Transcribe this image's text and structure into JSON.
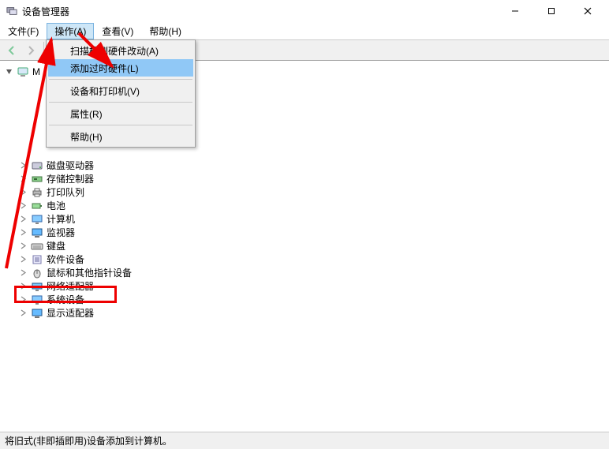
{
  "window": {
    "title": "设备管理器"
  },
  "menubar": {
    "file": "文件(F)",
    "action": "操作(A)",
    "view": "查看(V)",
    "help": "帮助(H)"
  },
  "dropdown": {
    "scan": "扫描检测硬件改动(A)",
    "addLegacy": "添加过时硬件(L)",
    "devPrinters": "设备和打印机(V)",
    "properties": "属性(R)",
    "help": "帮助(H)"
  },
  "tree": {
    "root": "M",
    "items": [
      "磁盘驱动器",
      "存储控制器",
      "打印队列",
      "电池",
      "计算机",
      "监视器",
      "键盘",
      "软件设备",
      "鼠标和其他指针设备",
      "网络适配器",
      "系统设备",
      "显示适配器"
    ]
  },
  "statusbar": {
    "text": "将旧式(非即插即用)设备添加到计算机。"
  },
  "iconset": {
    "computer": "computer-icon",
    "disk": "disk-icon",
    "storage": "storage-icon",
    "printer": "printer-icon",
    "battery": "battery-icon",
    "desktop": "desktop-icon",
    "monitor": "monitor-icon",
    "keyboard": "keyboard-icon",
    "software": "software-icon",
    "mouse": "mouse-icon",
    "network": "network-icon",
    "system": "system-icon",
    "display": "display-icon"
  }
}
